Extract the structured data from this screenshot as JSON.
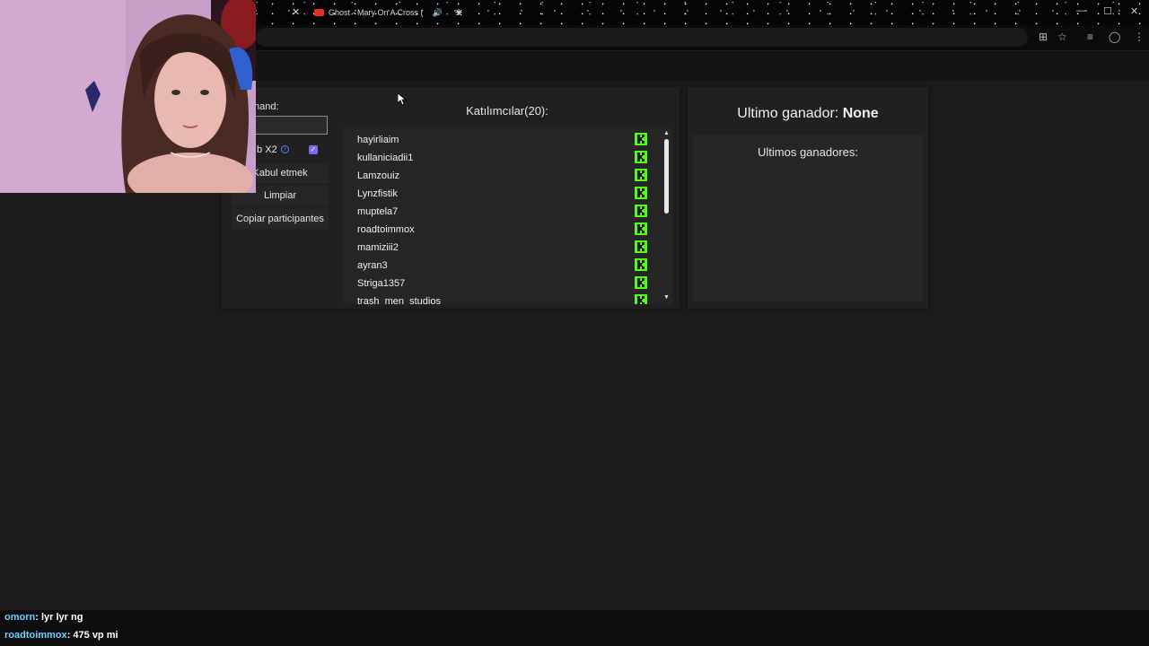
{
  "browser": {
    "tab_title": "Ghost - Mary On A Cross (",
    "new_tab": "+",
    "close": "✕",
    "speaker": "🔊",
    "win_min": "—",
    "win_max": "☐",
    "win_close": "✕"
  },
  "toolbar_icons": [
    "translate-icon",
    "star-icon",
    "media-icon",
    "profile-icon",
    "menu-icon"
  ],
  "controls": {
    "command_label": "nand:",
    "command_value": "",
    "sub_label": "ıb X2",
    "sub_checked": true,
    "accept_button": "Kabul etmek",
    "clear_button": "Limpiar",
    "copy_button": "Copiar participantes"
  },
  "participants": {
    "title": "Katılımcılar(20):",
    "names": [
      "hayirliaim",
      "kullaniciadii1",
      "Lamzouiz",
      "Lynzfistik",
      "muptela7",
      "roadtoimmox",
      "mamiziii2",
      "ayran3",
      "Striga1357",
      "trash_men_studios"
    ]
  },
  "winner": {
    "label": "Ultimo ganador:",
    "value": "None",
    "list_title": "Ultimos ganadores:"
  },
  "chat": [
    {
      "user": "omorn",
      "message": ": lyr lyr ng"
    },
    {
      "user": "roadtoimmox",
      "message": ": 475 vp mi"
    }
  ],
  "colors": {
    "kick_green": "#53fc18",
    "accent_purple": "#7a6cf0",
    "chat_user": "#6fd0ff"
  }
}
